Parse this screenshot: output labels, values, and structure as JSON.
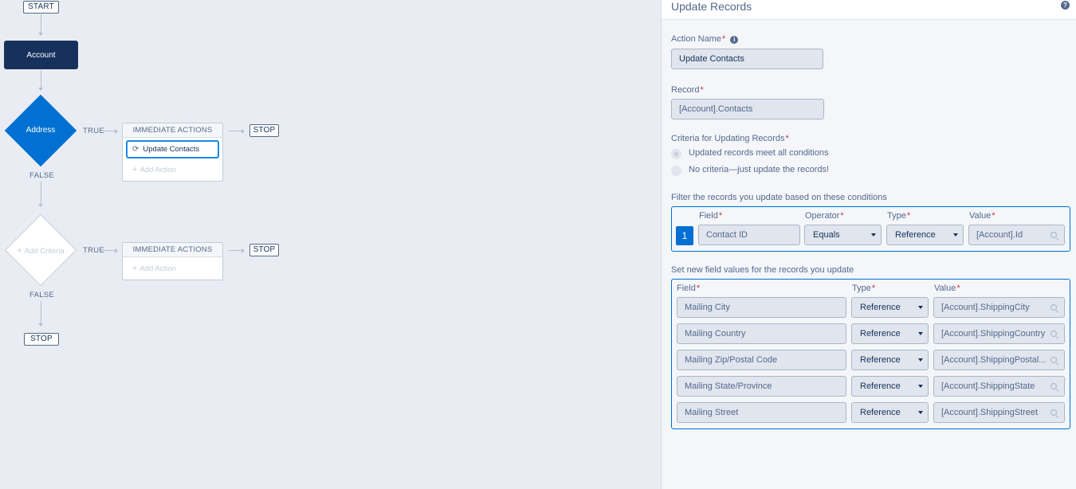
{
  "flow": {
    "start_label": "START",
    "object_node_label": "Account",
    "criteria_1_label": "Address",
    "criteria_2_label": "Add Criteria",
    "true_label": "TRUE",
    "false_label": "FALSE",
    "immediate_actions_label": "IMMEDIATE ACTIONS",
    "action_1_label": "Update Contacts",
    "add_action_label": "Add Action",
    "stop_label": "STOP"
  },
  "panel": {
    "title": "Update Records",
    "action_name_label": "Action Name",
    "action_name_value": "Update Contacts",
    "record_label": "Record",
    "record_value": "[Account].Contacts",
    "criteria_label": "Criteria for Updating Records",
    "radio_options": [
      "Updated records meet all conditions",
      "No criteria—just update the records!"
    ],
    "filter_label": "Filter the records you update based on these conditions",
    "filter_columns": {
      "field": "Field",
      "operator": "Operator",
      "type": "Type",
      "value": "Value"
    },
    "filter_row": {
      "index": "1",
      "field": "Contact ID",
      "operator": "Equals",
      "type": "Reference",
      "value": "[Account].Id"
    },
    "set_label": "Set new field values for the records you update",
    "set_columns": {
      "field": "Field",
      "type": "Type",
      "value": "Value"
    },
    "set_rows": [
      {
        "field": "Mailing City",
        "type": "Reference",
        "value": "[Account].ShippingCity"
      },
      {
        "field": "Mailing Country",
        "type": "Reference",
        "value": "[Account].ShippingCountry"
      },
      {
        "field": "Mailing Zip/Postal Code",
        "type": "Reference",
        "value": "[Account].ShippingPostal..."
      },
      {
        "field": "Mailing State/Province",
        "type": "Reference",
        "value": "[Account].ShippingState"
      },
      {
        "field": "Mailing Street",
        "type": "Reference",
        "value": "[Account].ShippingStreet"
      }
    ]
  },
  "colors": {
    "accent": "#0070d2",
    "navy": "#16325c",
    "required": "#c23934"
  }
}
